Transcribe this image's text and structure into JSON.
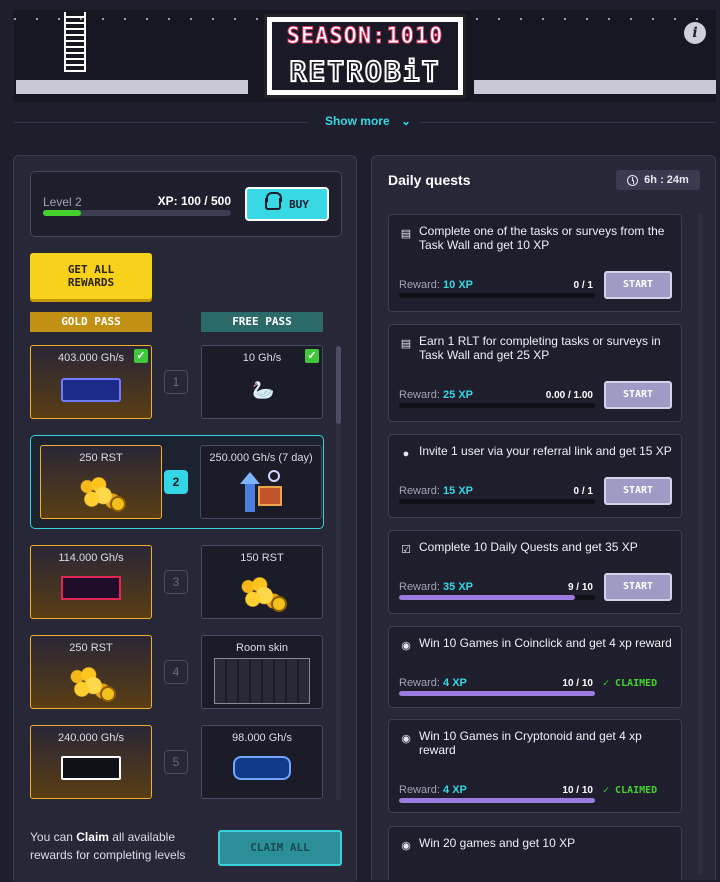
{
  "banner": {
    "logo_line1": "SEASON:1010",
    "logo_line2": "RETROBiT",
    "info_icon": "i"
  },
  "show_more": "Show more",
  "level": {
    "label": "Level 2",
    "xp_text": "XP: 100 / 500",
    "xp_current": 100,
    "xp_max": 500,
    "buy_label": "BUY"
  },
  "get_all_label": "GET ALL REWARDS",
  "gold_pass_label": "GOLD PASS",
  "free_pass_label": "FREE PASS",
  "rewards": [
    {
      "level": "1",
      "gold": "403.000 Gh/s",
      "free": "10 Gh/s",
      "gold_claimed": true,
      "free_claimed": true
    },
    {
      "level": "2",
      "gold": "250 RST",
      "free": "250.000 Gh/s (7 day)",
      "active": true
    },
    {
      "level": "3",
      "gold": "114.000 Gh/s",
      "free": "150 RST"
    },
    {
      "level": "4",
      "gold": "250 RST",
      "free": "Room skin"
    },
    {
      "level": "5",
      "gold": "240.000 Gh/s",
      "free": "98.000 Gh/s"
    }
  ],
  "footer": {
    "text_before": "You can ",
    "text_bold": "Claim",
    "text_after": " all available rewards for completing levels",
    "claim_all_label": "CLAIM ALL"
  },
  "quests": {
    "title": "Daily quests",
    "timer": "6h : 24m",
    "reward_label": "Reward:",
    "start_label": "START",
    "claimed_label": "CLAIMED",
    "items": [
      {
        "text": "Complete one of the tasks or surveys from the Task Wall and get 10 XP",
        "reward": "10 XP",
        "progress": "0 / 1",
        "fraction": 0,
        "icon": "clipboard-icon",
        "state": "start"
      },
      {
        "text": "Earn 1 RLT for completing tasks or surveys in Task Wall and get 25 XP",
        "reward": "25 XP",
        "progress": "0.00 / 1.00",
        "fraction": 0,
        "icon": "clipboard-icon",
        "state": "start"
      },
      {
        "text": "Invite 1 user via your referral link and get 15 XP",
        "reward": "15 XP",
        "progress": "0 / 1",
        "fraction": 0,
        "icon": "user-icon",
        "state": "start"
      },
      {
        "text": "Complete 10 Daily Quests and get 35 XP",
        "reward": "35 XP",
        "progress": "9 / 10",
        "fraction": 0.9,
        "icon": "checklist-icon",
        "state": "start"
      },
      {
        "text": "Win 10 Games in Coinclick and get 4 xp reward",
        "reward": "4 XP",
        "progress": "10 / 10",
        "fraction": 1,
        "icon": "gamepad-icon",
        "state": "claimed"
      },
      {
        "text": "Win 10 Games in Cryptonoid and get 4 xp reward",
        "reward": "4 XP",
        "progress": "10 / 10",
        "fraction": 1,
        "icon": "gamepad-icon",
        "state": "claimed"
      },
      {
        "text": "Win 20 games and get 10 XP",
        "icon": "gamepad-icon",
        "state": "partial"
      }
    ]
  },
  "colors": {
    "accent": "#38d7e4",
    "gold": "#f0b02a",
    "progress_purple": "#9c7be0",
    "green": "#45d22e"
  }
}
